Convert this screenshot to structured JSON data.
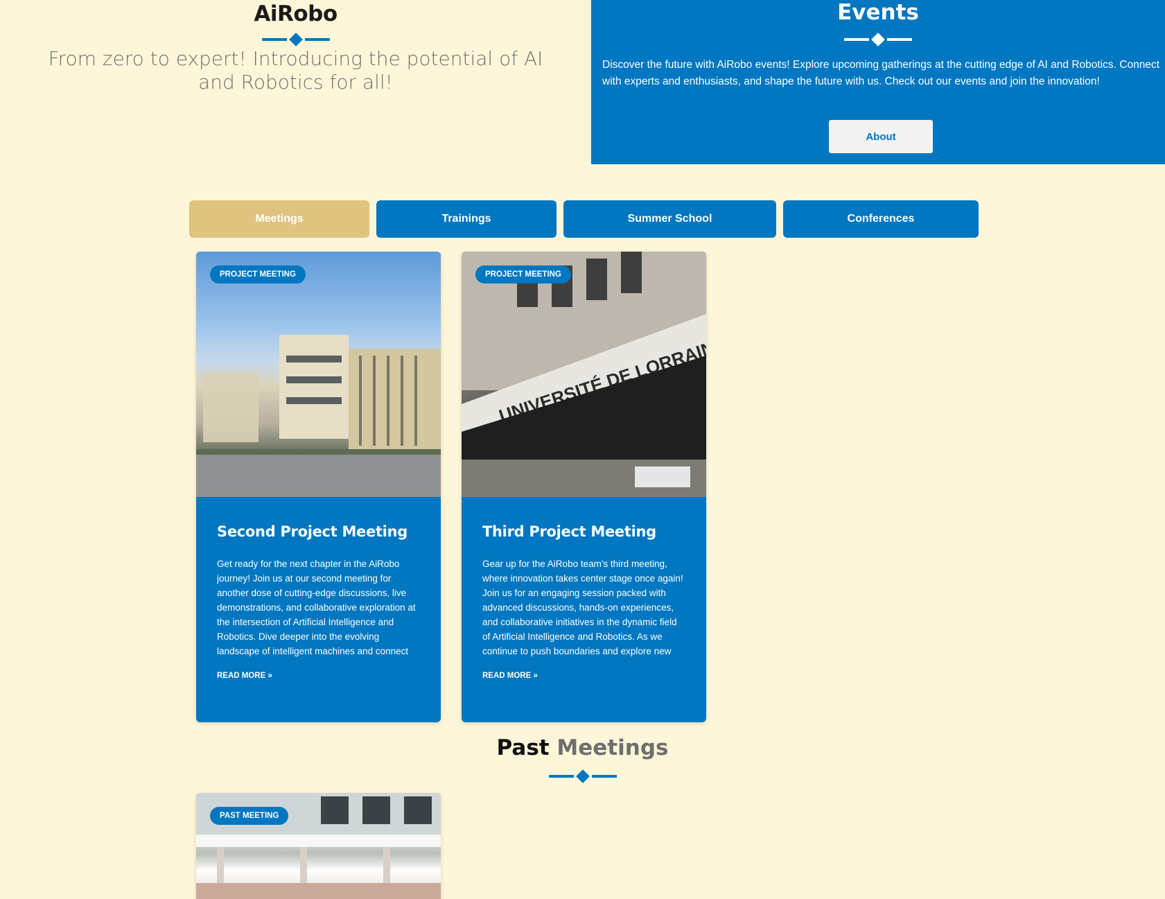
{
  "hero": {
    "brand_prefix": "Ai",
    "brand_suffix": "Robo",
    "tagline": "From zero to expert! Introducing the potential of AI and Robotics for all!"
  },
  "events": {
    "title": "Events",
    "description": "Discover the future with AiRobo events! Explore upcoming gatherings at the cutting edge of AI and Robotics. Connect with experts and enthusiasts, and shape the future with us. Check out our events and join the innovation!",
    "about_button": "About"
  },
  "tabs": [
    {
      "label": "Meetings",
      "active": true
    },
    {
      "label": "Trainings",
      "active": false
    },
    {
      "label": "Summer School",
      "active": false
    },
    {
      "label": "Conferences",
      "active": false
    }
  ],
  "cards": [
    {
      "badge": "PROJECT MEETING",
      "title": "Second Project Meeting",
      "excerpt": "Get ready for the next chapter in the AiRobo journey! Join us at our second meeting for another dose of cutting-edge discussions, live demonstrations, and collaborative exploration at the intersection of Artificial Intelligence and Robotics. Dive deeper into the evolving landscape of intelligent machines and connect with fellow enthusiasts who",
      "read_more": "READ MORE »"
    },
    {
      "badge": "PROJECT MEETING",
      "title": "Third Project Meeting",
      "excerpt": "Gear up for the AiRobo team's third meeting, where innovation takes center stage once again! Join us for an engaging session packed with advanced discussions, hands-on experiences, and collaborative initiatives in the dynamic field of Artificial Intelligence and Robotics. As we continue to push boundaries and explore new horizons, this",
      "read_more": "READ MORE »",
      "image_text": "UNIVERSITÉ DE LORRAINE"
    }
  ],
  "past": {
    "heading_word1": "Past",
    "heading_word2": "Meetings",
    "cards": [
      {
        "badge": "PAST MEETING"
      }
    ]
  },
  "colors": {
    "background": "#fef6d9",
    "primary": "#0077c0",
    "active_tab": "#e0c37e"
  }
}
